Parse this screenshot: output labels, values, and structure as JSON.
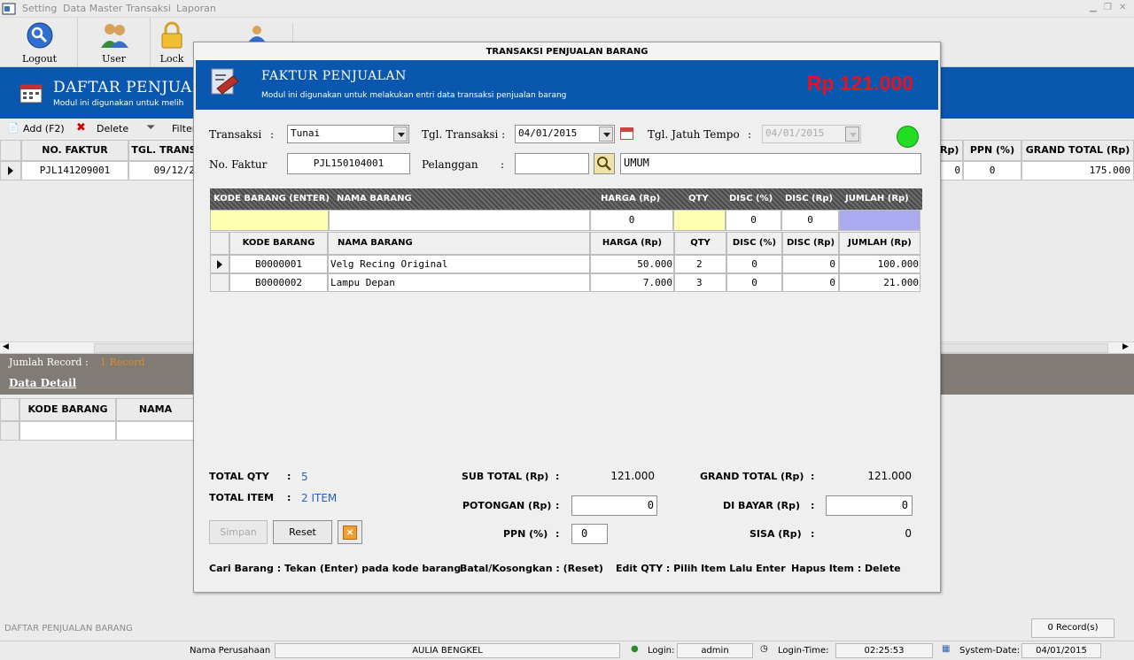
{
  "menubar": {
    "items": [
      "Setting",
      "Data Master",
      "Transaksi",
      "Laporan"
    ]
  },
  "toolbar": {
    "buttons": [
      {
        "label": "Logout",
        "icon": "logout-icon"
      },
      {
        "label": "User",
        "icon": "user-icon"
      },
      {
        "label": "Lock",
        "icon": "lock-icon"
      }
    ]
  },
  "background": {
    "title": "DAFTAR PENJUALA",
    "subtitle": "Modul ini digunakan untuk melih",
    "actions": {
      "add": "Add (F2)",
      "delete": "Delete",
      "filter": "Filter"
    },
    "columns": {
      "no_faktur": "NO. FAKTUR",
      "tgl_trans": "TGL. TRANS",
      "rp": "Rp)",
      "ppn": "PPN (%)",
      "grand_total": "GRAND TOTAL (Rp)"
    },
    "row": {
      "no_faktur": "PJL141209001",
      "tgl": "09/12/2",
      "rp": "0",
      "ppn": "0",
      "grand_total": "175.000"
    },
    "record_label": "Jumlah Record :",
    "record_value": "1 Record",
    "detail_title": "Data Detail",
    "detail_columns": {
      "kode": "KODE BARANG",
      "nama": "NAMA"
    },
    "footer_label": "DAFTAR PENJUALAN BARANG",
    "record_count": "0 Record(s)"
  },
  "statusbar": {
    "company_label": "Nama Perusahaan",
    "company": "AULIA BENGKEL",
    "login_label": "Login:",
    "login": "admin",
    "login_time_label": "Login-Time:",
    "login_time": "02:25:53",
    "system_date_label": "System-Date:",
    "system_date": "04/01/2015"
  },
  "modal": {
    "window_title": "TRANSAKSI PENJUALAN BARANG",
    "title": "FAKTUR PENJUALAN",
    "subtitle": "Modul ini digunakan untuk melakukan entri data transaksi penjualan barang",
    "total_display": "Rp 121.000",
    "form": {
      "transaksi_label": "Transaksi",
      "transaksi_value": "Tunai",
      "tgl_transaksi_label": "Tgl. Transaksi :",
      "tgl_transaksi_value": "04/01/2015",
      "jatuh_tempo_label": "Tgl. Jatuh Tempo",
      "jatuh_tempo_colon": ":",
      "jatuh_tempo_value": "04/01/2015",
      "no_faktur_label": "No. Faktur",
      "no_faktur_value": "PJL150104001",
      "pelanggan_label": "Pelanggan",
      "pelanggan_colon": ":",
      "pelanggan_code": "",
      "pelanggan_name": "UMUM",
      "status_color": "#22dd22"
    },
    "entry": {
      "headers": {
        "kode": "KODE BARANG (ENTER)",
        "nama": "NAMA BARANG",
        "harga": "HARGA (Rp)",
        "qty": "QTY",
        "disc_pct": "DISC (%)",
        "disc_rp": "DISC (Rp)",
        "jumlah": "JUMLAH (Rp)"
      },
      "values": {
        "kode": "",
        "nama": "",
        "harga": "0",
        "qty": "",
        "disc_pct": "0",
        "disc_rp": "0",
        "jumlah": ""
      }
    },
    "grid": {
      "headers": {
        "kode": "KODE BARANG",
        "nama": "NAMA BARANG",
        "harga": "HARGA (Rp)",
        "qty": "QTY",
        "disc_pct": "DISC (%)",
        "disc_rp": "DISC (Rp)",
        "jumlah": "JUMLAH (Rp)"
      },
      "rows": [
        {
          "kode": "B0000001",
          "nama": "Velg Recing Original",
          "harga": "50.000",
          "qty": "2",
          "disc_pct": "0",
          "disc_rp": "0",
          "jumlah": "100.000"
        },
        {
          "kode": "B0000002",
          "nama": "Lampu Depan",
          "harga": "7.000",
          "qty": "3",
          "disc_pct": "0",
          "disc_rp": "0",
          "jumlah": "21.000"
        }
      ]
    },
    "totals": {
      "total_qty_label": "TOTAL QTY",
      "total_qty": "5",
      "total_item_label": "TOTAL ITEM",
      "total_item": "2 ITEM",
      "colon": ":",
      "sub_total_label": "SUB TOTAL (Rp)",
      "sub_total": "121.000",
      "potongan_label": "POTONGAN (Rp)",
      "potongan": "0",
      "ppn_label": "PPN (%)",
      "ppn": "0",
      "grand_total_label": "GRAND TOTAL (Rp)",
      "grand_total": "121.000",
      "dibayar_label": "DI BAYAR (Rp)",
      "dibayar": "0",
      "sisa_label": "SISA (Rp)",
      "sisa": "0"
    },
    "buttons": {
      "simpan": "Simpan",
      "reset": "Reset"
    },
    "hints": {
      "cari": "Cari Barang : Tekan (Enter) pada kode barang",
      "batal": "Batal/Kosongkan : (Reset)",
      "edit": "Edit QTY : Pilih Item Lalu Enter",
      "hapus": "Hapus Item : Delete"
    }
  }
}
